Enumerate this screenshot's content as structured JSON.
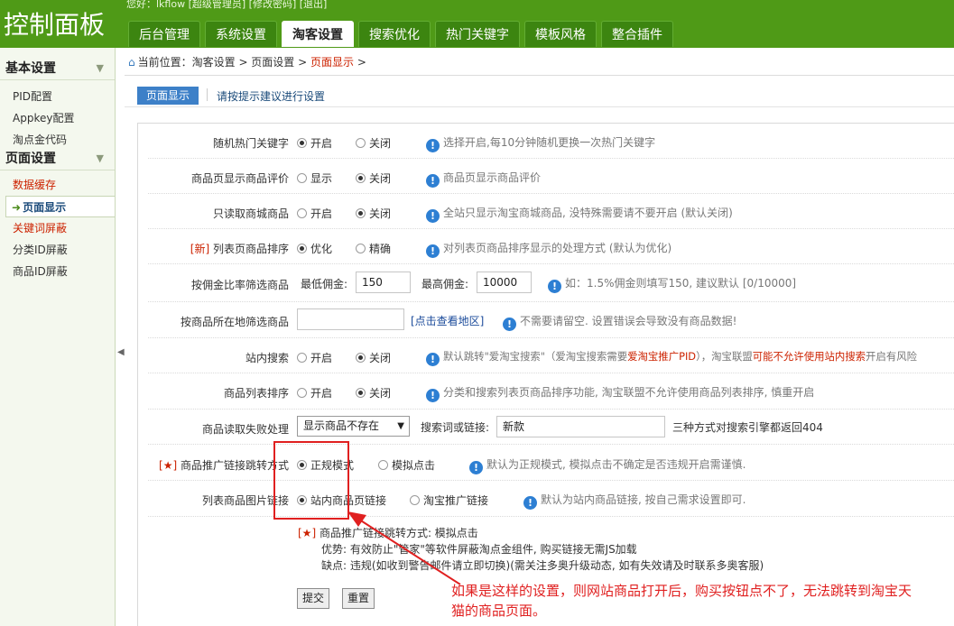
{
  "header": {
    "brand": "控制面板",
    "userbar": "您好：lkflow [超级管理员]   [修改密码]  [退出]",
    "tabs": [
      "后台管理",
      "系统设置",
      "淘客设置",
      "搜索优化",
      "热门关键字",
      "模板风格",
      "整合插件"
    ],
    "active_tab": "淘客设置"
  },
  "sidebar": {
    "groups": [
      {
        "title": "基本设置",
        "items": [
          "PID配置",
          "Appkey配置",
          "淘点金代码"
        ]
      },
      {
        "title": "页面设置",
        "items": [
          "数据缓存",
          "页面显示",
          "关键词屏蔽",
          "分类ID屏蔽",
          "商品ID屏蔽"
        ]
      }
    ],
    "active_item": "页面显示"
  },
  "breadcrumb": {
    "prefix": "当前位置：淘客设置 > 页面设置 > ",
    "current": "页面显示",
    "suffix": " >"
  },
  "subtab": "页面显示",
  "hint": "请按提示建议进行设置",
  "rows": {
    "r1": {
      "label": "随机热门关键字",
      "opt1": "开启",
      "opt2": "关闭",
      "note": "选择开启,每10分钟随机更换一次热门关键字"
    },
    "r2": {
      "label": "商品页显示商品评价",
      "opt1": "显示",
      "opt2": "关闭",
      "note": "商品页显示商品评价"
    },
    "r3": {
      "label": "只读取商城商品",
      "opt1": "开启",
      "opt2": "关闭",
      "note": "全站只显示淘宝商城商品, 没特殊需要请不要开启 (默认关闭)"
    },
    "r4": {
      "label_tag": "[新]",
      "label": " 列表页商品排序",
      "opt1": "优化",
      "opt2": "精确",
      "note": "对列表页商品排序显示的处理方式 (默认为优化)"
    },
    "r5": {
      "label": "按佣金比率筛选商品",
      "min_label": "最低佣金:",
      "min_value": "150",
      "max_label": "最高佣金:",
      "max_value": "10000",
      "note": "如：1.5%佣金则填写150, 建议默认 [0/10000]"
    },
    "r6": {
      "label": "按商品所在地筛选商品",
      "link": "[点击查看地区]",
      "note": "不需要请留空. 设置错误会导致没有商品数据!"
    },
    "r7": {
      "label": "站内搜索",
      "opt1": "开启",
      "opt2": "关闭",
      "note_a": "默认跳转\"爱淘宝搜索\"（爱淘宝搜索需要",
      "note_red1": "爱淘宝推广PID",
      "note_b": "），淘宝联盟",
      "note_red2": "可能不允许使用站内搜索",
      "note_c": "开启有风险"
    },
    "r8": {
      "label": "商品列表排序",
      "opt1": "开启",
      "opt2": "关闭",
      "note": "分类和搜索列表页商品排序功能, 淘宝联盟不允许使用商品列表排序, 慎重开启"
    },
    "r9": {
      "label": "商品读取失败处理",
      "select_value": "显示商品不存在",
      "kw_label": "搜索词或链接:",
      "kw_value": "新款",
      "note": "三种方式对搜索引擎都返回404"
    },
    "r10": {
      "label_tag": "[★]",
      "label": " 商品推广链接跳转方式",
      "opt1": "正规模式",
      "opt2": "模拟点击",
      "note": "默认为正规模式, 模拟点击不确定是否违规开启需谨慎."
    },
    "r11": {
      "label": "列表商品图片链接",
      "opt1": "站内商品页链接",
      "opt2": "淘宝推广链接",
      "note": "默认为站内商品链接, 按自己需求设置即可."
    }
  },
  "info_block": {
    "tag": "[★]",
    "line1": " 商品推广链接跳转方式: 模拟点击",
    "line2": "优势: 有效防止\"管家\"等软件屏蔽淘点金组件, 购买链接无需JS加载",
    "line3": "缺点: 违规(如收到警告邮件请立即切换)(需关注多奥升级动态, 如有失效请及时联系多奥客服)"
  },
  "buttons": {
    "submit": "提交",
    "reset": "重置"
  },
  "annotation": "如果是这样的设置，则网站商品打开后，购买按钮点不了，无法跳转到淘宝天猫的商品页面。",
  "colors": {
    "header_green": "#4f9a17",
    "accent_blue": "#3d80c8",
    "annotation_red": "#e02020"
  },
  "icons": {
    "info": "info-icon",
    "home": "home-icon",
    "collapse": "collapse-arrow-icon"
  }
}
